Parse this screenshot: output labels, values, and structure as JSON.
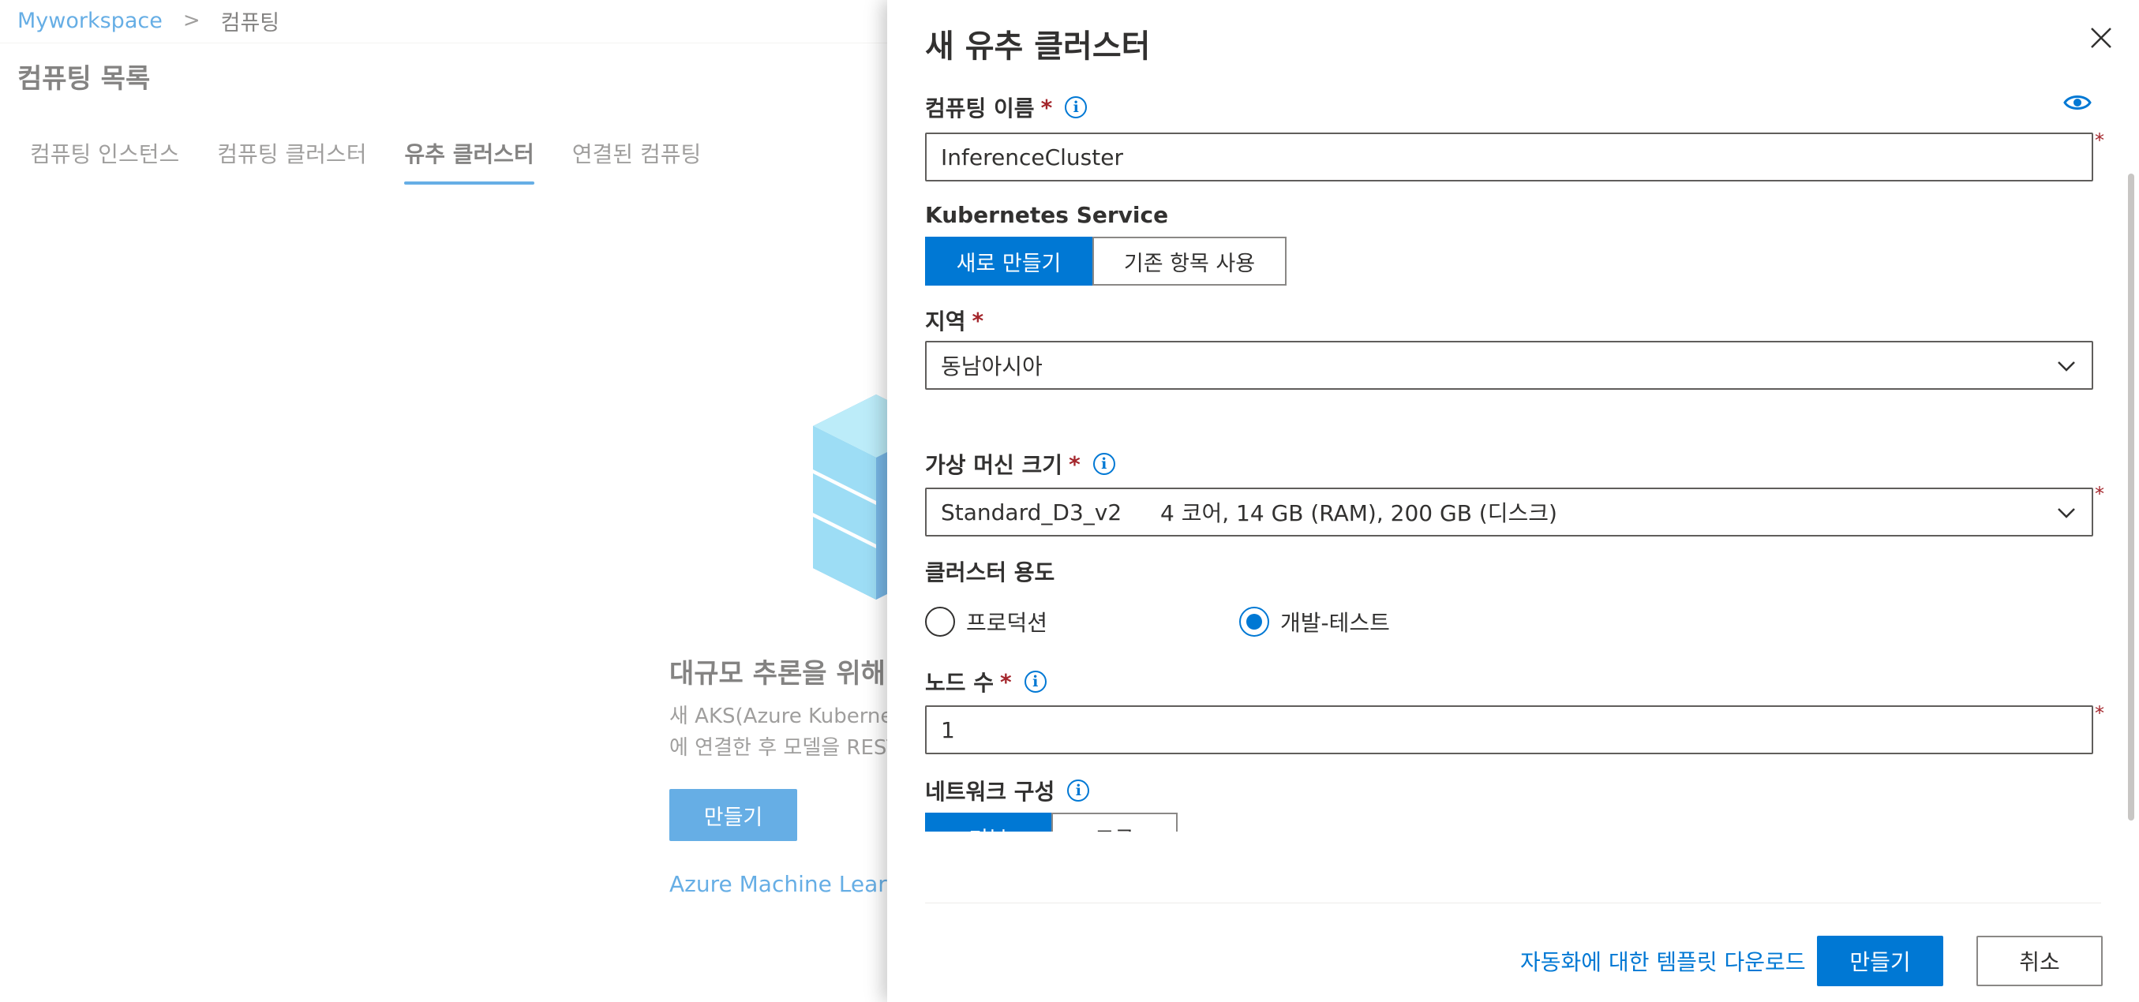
{
  "breadcrumb": {
    "workspace": "Myworkspace",
    "separator": ">",
    "current": "컴퓨팅"
  },
  "page_title": "컴퓨팅 목록",
  "tabs": [
    {
      "label": "컴퓨팅 인스턴스"
    },
    {
      "label": "컴퓨팅 클러스터"
    },
    {
      "label": "유추 클러스터",
      "active": true
    },
    {
      "label": "연결된 컴퓨팅"
    }
  ],
  "empty_state": {
    "title": "대규모 추론을 위해",
    "desc_line1": "새 AKS(Azure Kubernet",
    "desc_line2": "에 연결한 후 모델을 REST",
    "create_label": "만들기",
    "learn_link": "Azure Machine Learnin"
  },
  "panel": {
    "title": "새 유추 클러스터",
    "compute_name": {
      "label": "컴퓨팅 이름",
      "required": "*",
      "value": "InferenceCluster"
    },
    "kubernetes": {
      "label": "Kubernetes Service",
      "options": [
        "새로 만들기",
        "기존 항목 사용"
      ],
      "selected": "새로 만들기"
    },
    "region": {
      "label": "지역",
      "required": "*",
      "value": "동남아시아"
    },
    "vm_size": {
      "label": "가상 머신 크기",
      "required": "*",
      "name": "Standard_D3_v2",
      "spec": "4 코어, 14 GB (RAM), 200 GB (디스크)"
    },
    "purpose": {
      "label": "클러스터 용도",
      "options": [
        "프로덕션",
        "개발-테스트"
      ],
      "selected": "개발-테스트"
    },
    "node_count": {
      "label": "노드 수",
      "required": "*",
      "value": "1"
    },
    "network": {
      "label": "네트워크 구성",
      "options": [
        "기본",
        "고급"
      ]
    },
    "footer": {
      "template_link": "자동화에 대한 템플릿 다운로드",
      "create": "만들기",
      "cancel": "취소"
    }
  },
  "colors": {
    "accent": "#0078d4",
    "required": "#a4262c",
    "text": "#323130"
  }
}
